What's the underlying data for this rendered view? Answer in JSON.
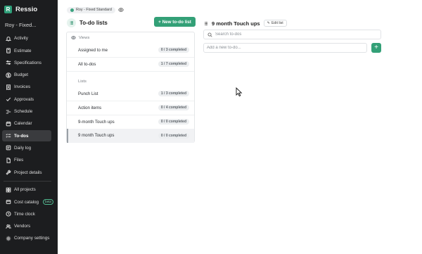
{
  "sidebar": {
    "brand": "Ressio",
    "project": "Roy - Fixed...",
    "items": [
      {
        "label": "Activity",
        "icon": "bell-icon"
      },
      {
        "label": "Estimate",
        "icon": "calculator-icon"
      },
      {
        "label": "Specifications",
        "icon": "sliders-icon"
      },
      {
        "label": "Budget",
        "icon": "dollar-icon"
      },
      {
        "label": "Invoices",
        "icon": "invoice-icon"
      },
      {
        "label": "Approvals",
        "icon": "check-icon"
      },
      {
        "label": "Schedule",
        "icon": "schedule-icon"
      },
      {
        "label": "Calendar",
        "icon": "calendar-icon"
      },
      {
        "label": "To-dos",
        "icon": "checklist-icon",
        "active": true
      },
      {
        "label": "Daily log",
        "icon": "log-icon"
      },
      {
        "label": "Files",
        "icon": "file-icon"
      },
      {
        "label": "Project details",
        "icon": "wrench-icon"
      }
    ],
    "bottom_items": [
      {
        "label": "All projects",
        "icon": "grid-icon"
      },
      {
        "label": "Cost catalog",
        "icon": "catalog-icon",
        "badge": "beta"
      },
      {
        "label": "Time clock",
        "icon": "clock-icon"
      },
      {
        "label": "Vendors",
        "icon": "users-icon"
      },
      {
        "label": "Company settings",
        "icon": "gear-icon"
      }
    ]
  },
  "breadcrumb": {
    "label": "Roy - Fixed Standard"
  },
  "lists_panel": {
    "title": "To-do lists",
    "new_button": "+ New to-do list",
    "views_label": "Views",
    "views": [
      {
        "name": "Assigned to me",
        "count": "0 / 3 completed"
      },
      {
        "name": "All to-dos",
        "count": "1 / 7 completed"
      }
    ],
    "lists_label": "Lists",
    "lists": [
      {
        "name": "Punch List",
        "count": "1 / 3 completed"
      },
      {
        "name": "Action items",
        "count": "0 / 4 completed"
      },
      {
        "name": "9-month Touch ups",
        "count": "0 / 0 completed"
      },
      {
        "name": "9 month Touch ups",
        "count": "0 / 0 completed",
        "selected": true
      }
    ]
  },
  "detail": {
    "title": "9 month Touch ups",
    "edit_button": "Edit list",
    "search_placeholder": "Search to-dos",
    "add_placeholder": "Add a new to-do...",
    "add_button": "+"
  },
  "colors": {
    "accent": "#33a077",
    "sidebar_bg": "#1c1d1f"
  }
}
